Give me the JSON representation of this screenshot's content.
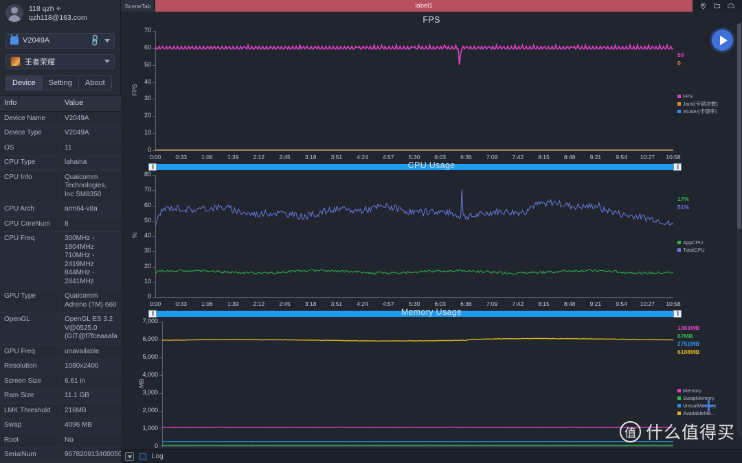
{
  "sidebar": {
    "account": {
      "name": "118 qzh",
      "email": "qzh118@163.com",
      "power_icon": "⏻"
    },
    "device_select": {
      "value": "V2049A",
      "device_icon": "android-icon",
      "link_icon": "link-icon"
    },
    "app_select": {
      "value": "王者荣耀",
      "app_icon": "game-app-icon"
    },
    "tabs": [
      {
        "label": "Device",
        "active": true
      },
      {
        "label": "Setting",
        "active": false
      },
      {
        "label": "About",
        "active": false
      }
    ],
    "table": {
      "headers": [
        "Info",
        "Value"
      ],
      "rows": [
        {
          "info": "Device Name",
          "value": "V2049A"
        },
        {
          "info": "Device Type",
          "value": "V2049A"
        },
        {
          "info": "OS",
          "value": "11"
        },
        {
          "info": "CPU Type",
          "value": "lahaina"
        },
        {
          "info": "CPU Info",
          "value": "Qualcomm Technologies, Inc SM8350"
        },
        {
          "info": "CPU Arch",
          "value": "arm64-v8a"
        },
        {
          "info": "CPU CoreNum",
          "value": "8"
        },
        {
          "info": "CPU Freq",
          "value": "300MHz - 1804MHz\n710MHz - 2419MHz\n844MHz - 2841MHz"
        },
        {
          "info": "GPU Type",
          "value": "Qualcomm Adreno (TM) 660"
        },
        {
          "info": "OpenGL",
          "value": "OpenGL ES 3.2 V@0525.0 (GIT@f7fceaaafa"
        },
        {
          "info": "GPU Freq",
          "value": "unavailable"
        },
        {
          "info": "Resolution",
          "value": "1080x2400"
        },
        {
          "info": "Screen Size",
          "value": "6.61 in"
        },
        {
          "info": "Ram Size",
          "value": "11.1 GB"
        },
        {
          "info": "LMK Threshold",
          "value": "216MB"
        },
        {
          "info": "Swap",
          "value": "4096 MB"
        },
        {
          "info": "Root",
          "value": "No"
        },
        {
          "info": "SerialNum",
          "value": "967820913400050"
        }
      ]
    }
  },
  "topbar": {
    "scene_tab": "SceneTab",
    "label": "label1",
    "icons": [
      "location-pin-icon",
      "folder-icon",
      "cloud-icon"
    ]
  },
  "playback": {
    "play_label": "play-button"
  },
  "bottombar": {
    "expand_icon": "collapse-icon",
    "log_label": "Log",
    "log_checked": false
  },
  "watermark": {
    "logo": "值",
    "text": "什么值得买"
  },
  "xticks": [
    "0:00",
    "0:33",
    "1:06",
    "1:39",
    "2:12",
    "2:45",
    "3:18",
    "3:51",
    "4:24",
    "4:57",
    "5:30",
    "6:03",
    "6:36",
    "7:09",
    "7:42",
    "8:15",
    "8:48",
    "9:21",
    "9:54",
    "10:27",
    "10:58"
  ],
  "chart_data": [
    {
      "type": "line",
      "title": "FPS",
      "xlabel": "",
      "ylabel": "FPS",
      "ylim": [
        0,
        70
      ],
      "yticks": [
        0,
        10,
        20,
        30,
        40,
        50,
        60,
        70
      ],
      "x": [
        "0:00",
        "0:33",
        "1:06",
        "1:39",
        "2:12",
        "2:45",
        "3:18",
        "3:51",
        "4:24",
        "4:57",
        "5:30",
        "6:03",
        "6:36",
        "7:09",
        "7:42",
        "8:15",
        "8:48",
        "9:21",
        "9:54",
        "10:27",
        "10:58"
      ],
      "grid": false,
      "legend_position": "right",
      "series": [
        {
          "name": "FPS",
          "color": "#e040c8",
          "current_value": "59",
          "mean": 59
        },
        {
          "name": "Jank(卡顿次数)",
          "color": "#f08a2a",
          "current_value": "0",
          "mean": 0
        },
        {
          "name": "Stutter(卡顿率)",
          "color": "#2f8fe8",
          "current_value": "",
          "mean": 0
        }
      ],
      "value_labels": [
        {
          "text": "59",
          "color": "#e040c8"
        },
        {
          "text": "0",
          "color": "#f08a2a"
        }
      ]
    },
    {
      "type": "line",
      "title": "CPU Usage",
      "xlabel": "",
      "ylabel": "%",
      "ylim": [
        0,
        80
      ],
      "yticks": [
        0,
        10,
        20,
        30,
        40,
        50,
        60,
        70,
        80
      ],
      "x": [
        "0:00",
        "0:33",
        "1:06",
        "1:39",
        "2:12",
        "2:45",
        "3:18",
        "3:51",
        "4:24",
        "4:57",
        "5:30",
        "6:03",
        "6:36",
        "7:09",
        "7:42",
        "8:15",
        "8:48",
        "9:21",
        "9:54",
        "10:27",
        "10:58"
      ],
      "grid": false,
      "legend_position": "right",
      "series": [
        {
          "name": "AppCPU",
          "color": "#2db84d",
          "current_value": "17%",
          "mean": 17
        },
        {
          "name": "TotalCPU",
          "color": "#6b79e0",
          "current_value": "51%",
          "mean": 56
        }
      ],
      "value_labels": [
        {
          "text": "17%",
          "color": "#2db84d"
        },
        {
          "text": "51%",
          "color": "#6b79e0"
        }
      ]
    },
    {
      "type": "line",
      "title": "Memory Usage",
      "xlabel": "",
      "ylabel": "MB",
      "ylim": [
        0,
        7000
      ],
      "yticks": [
        "0",
        "1,000",
        "2,000",
        "3,000",
        "4,000",
        "5,000",
        "6,000",
        "7,000"
      ],
      "x": [
        "0:00",
        "0:33",
        "1:06",
        "1:39",
        "2:12",
        "2:45",
        "3:18",
        "3:51",
        "4:24",
        "4:57",
        "5:30",
        "6:03",
        "6:36",
        "7:09",
        "7:42",
        "8:15",
        "8:48",
        "9:21",
        "9:54",
        "10:27",
        "10:58"
      ],
      "grid": false,
      "legend_position": "right",
      "series": [
        {
          "name": "Memory",
          "color": "#e040c8",
          "current_value": "1083MB",
          "mean": 1083
        },
        {
          "name": "SwapMemory",
          "color": "#2db84d",
          "current_value": "67MB",
          "mean": 67
        },
        {
          "name": "VirtualMemory",
          "color": "#2f8fe8",
          "current_value": "2751MB",
          "mean": 275
        },
        {
          "name": "AvailableMe...",
          "color": "#d8b41e",
          "current_value": "6188MB",
          "mean": 5970
        }
      ],
      "value_labels": [
        {
          "text": "1083MB",
          "color": "#e040c8"
        },
        {
          "text": "67MB",
          "color": "#2db84d"
        },
        {
          "text": "2751MB",
          "color": "#2f8fe8"
        },
        {
          "text": "6188MB",
          "color": "#d8b41e"
        }
      ]
    }
  ]
}
